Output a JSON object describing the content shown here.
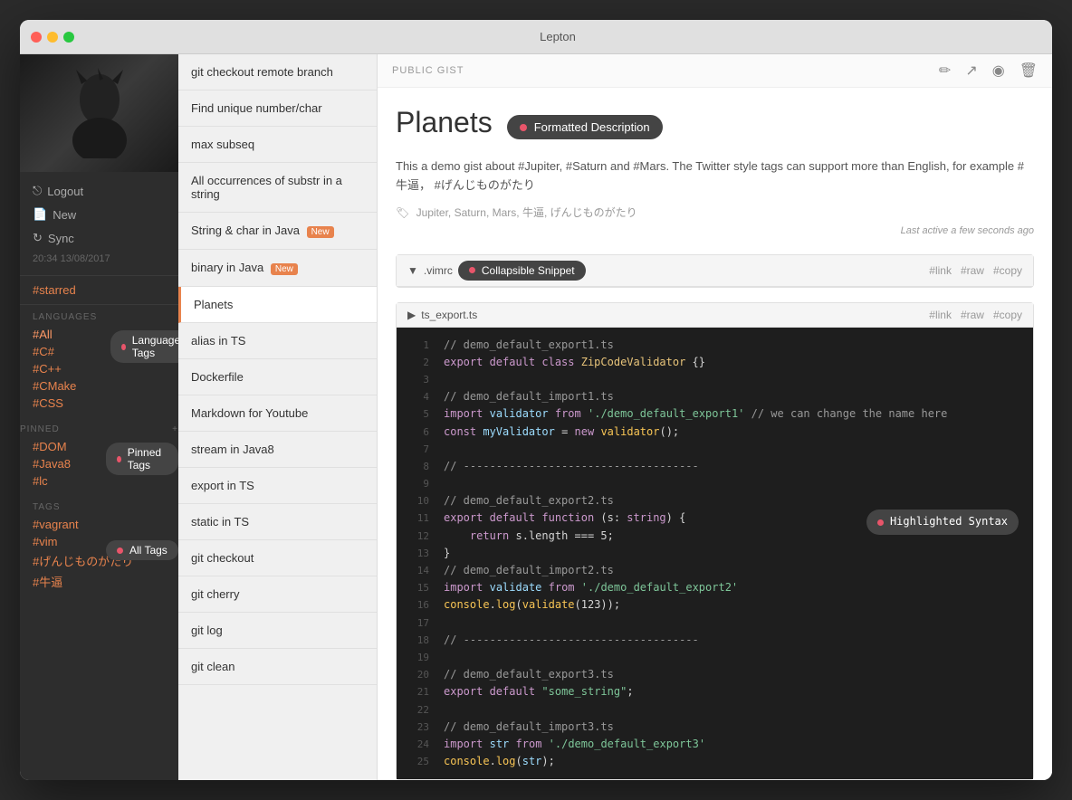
{
  "window": {
    "title": "Lepton"
  },
  "sidebar": {
    "actions": [
      {
        "label": "Logout",
        "icon": "→"
      },
      {
        "label": "New",
        "icon": "□"
      },
      {
        "label": "Sync",
        "icon": "↻"
      }
    ],
    "timestamp": "20:34 13/08/2017",
    "starred_tag": "#starred",
    "languages_label": "LANGUAGES",
    "languages": [
      {
        "label": "#All",
        "active": true
      },
      {
        "label": "#C#"
      },
      {
        "label": "#C++"
      },
      {
        "label": "#CMake"
      },
      {
        "label": "#CSS"
      }
    ],
    "pinned_label": "PINNED",
    "pinned_add_icon": "+",
    "pinned_tags": [
      {
        "label": "#DOM"
      },
      {
        "label": "#Java8"
      },
      {
        "label": "#lc"
      }
    ],
    "tags_label": "TAGS",
    "tags": [
      {
        "label": "#vagrant"
      },
      {
        "label": "#vim"
      },
      {
        "label": "#げんじものがたり"
      },
      {
        "label": "#牛逼"
      }
    ],
    "lang_tags_badge": "Language Tags",
    "pinned_tags_badge": "Pinned Tags",
    "all_tags_badge": "All Tags"
  },
  "list": {
    "items": [
      {
        "label": "git checkout remote branch",
        "active": false,
        "new": false
      },
      {
        "label": "Find unique number/char",
        "active": false,
        "new": false
      },
      {
        "label": "max subseq",
        "active": false,
        "new": false
      },
      {
        "label": "All occurrences of substr in a string",
        "active": false,
        "new": false
      },
      {
        "label": "String & char in Java",
        "active": false,
        "new": true
      },
      {
        "label": "binary in Java",
        "active": false,
        "new": true
      },
      {
        "label": "Planets",
        "active": true,
        "new": false
      },
      {
        "label": "alias in TS",
        "active": false,
        "new": false
      },
      {
        "label": "Dockerfile",
        "active": false,
        "new": false
      },
      {
        "label": "Markdown for Youtube",
        "active": false,
        "new": false
      },
      {
        "label": "stream in Java8",
        "active": false,
        "new": false
      },
      {
        "label": "export in TS",
        "active": false,
        "new": false
      },
      {
        "label": "static in TS",
        "active": false,
        "new": false
      },
      {
        "label": "git checkout",
        "active": false,
        "new": false
      },
      {
        "label": "git cherry",
        "active": false,
        "new": false
      },
      {
        "label": "git log",
        "active": false,
        "new": false
      },
      {
        "label": "git clean",
        "active": false,
        "new": false
      }
    ]
  },
  "detail": {
    "public_gist_label": "PUBLIC GIST",
    "icons": [
      "✏️",
      "↗",
      "👁",
      "🗑"
    ],
    "title": "Planets",
    "description": "This a demo gist about #Jupiter, #Saturn and #Mars. The Twitter style tags can support more than English, for example #牛逼，  #げんじものがたり",
    "tags": "Jupiter, Saturn, Mars, 牛逼, げんじものがたり",
    "last_active": "Last active a few seconds ago",
    "formatted_description_badge": "Formatted Description",
    "snippets": [
      {
        "filename": ".vimrc",
        "collapsible": true,
        "collapsible_badge": "Collapsible Snippet",
        "actions": [
          "#link",
          "#raw",
          "#copy"
        ]
      },
      {
        "filename": "ts_export.ts",
        "collapsible": false,
        "highlighted_badge": "Highlighted Syntax",
        "actions": [
          "#link",
          "#raw",
          "#copy"
        ]
      }
    ],
    "code_lines": [
      {
        "num": 1,
        "content": "// demo_default_export1.ts",
        "type": "comment"
      },
      {
        "num": 2,
        "content": "export default class ZipCodeValidator {}",
        "type": "code"
      },
      {
        "num": 3,
        "content": "",
        "type": "empty"
      },
      {
        "num": 4,
        "content": "// demo_default_import1.ts",
        "type": "comment"
      },
      {
        "num": 5,
        "content": "import validator from './demo_default_export1' // we can change the name here",
        "type": "code"
      },
      {
        "num": 6,
        "content": "const myValidator = new validator();",
        "type": "code"
      },
      {
        "num": 7,
        "content": "",
        "type": "empty"
      },
      {
        "num": 8,
        "content": "// ------------------------------------",
        "type": "comment"
      },
      {
        "num": 9,
        "content": "",
        "type": "empty"
      },
      {
        "num": 10,
        "content": "// demo_default_export2.ts",
        "type": "comment"
      },
      {
        "num": 11,
        "content": "export default function (s: string) {",
        "type": "code"
      },
      {
        "num": 12,
        "content": "    return s.length === 5;",
        "type": "code"
      },
      {
        "num": 13,
        "content": "}",
        "type": "code"
      },
      {
        "num": 14,
        "content": "// demo_default_import2.ts",
        "type": "comment"
      },
      {
        "num": 15,
        "content": "import validate from './demo_default_export2'",
        "type": "code"
      },
      {
        "num": 16,
        "content": "console.log(validate(123));",
        "type": "code"
      },
      {
        "num": 17,
        "content": "",
        "type": "empty"
      },
      {
        "num": 18,
        "content": "// ------------------------------------",
        "type": "comment"
      },
      {
        "num": 19,
        "content": "",
        "type": "empty"
      },
      {
        "num": 20,
        "content": "// demo_default_export3.ts",
        "type": "comment"
      },
      {
        "num": 21,
        "content": "export default \"some_string\";",
        "type": "code"
      },
      {
        "num": 22,
        "content": "",
        "type": "empty"
      },
      {
        "num": 23,
        "content": "// demo_default_import3.ts",
        "type": "comment"
      },
      {
        "num": 24,
        "content": "import str from './demo_default_export3'",
        "type": "code"
      },
      {
        "num": 25,
        "content": "console.log(str);",
        "type": "code"
      }
    ]
  }
}
